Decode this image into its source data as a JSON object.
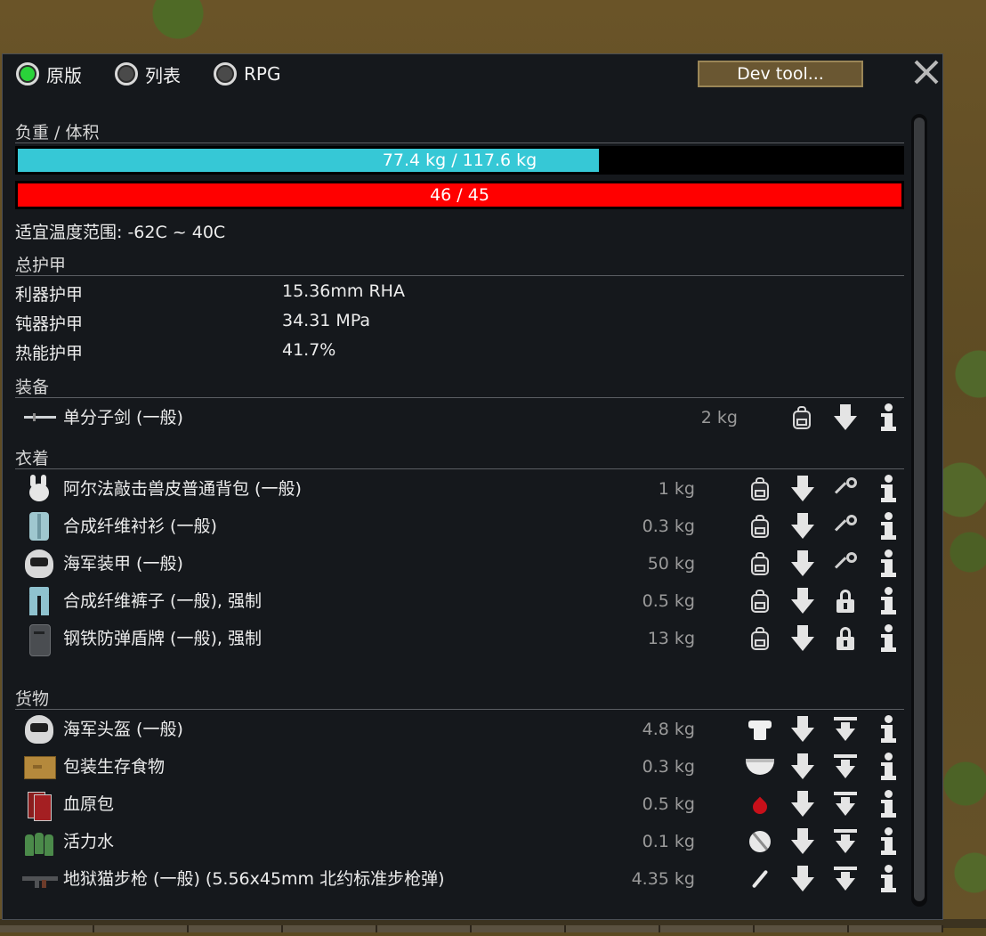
{
  "tabs": {
    "vanilla": "原版",
    "list": "列表",
    "rpg": "RPG",
    "selected": "原版"
  },
  "dev_tool_label": "Dev tool...",
  "load": {
    "title": "负重 / 体积",
    "mass_text": "77.4 kg / 117.6 kg",
    "mass_fraction": 0.658,
    "mass_color": "#36c8d6",
    "bulk_text": "46 / 45",
    "bulk_fraction": 1.0,
    "bulk_color": "#ff0000"
  },
  "temperature": "适宜温度范围: -62C ~ 40C",
  "armor": {
    "title": "总护甲",
    "rows": [
      {
        "label": "利器护甲",
        "value": "15.36mm RHA"
      },
      {
        "label": "钝器护甲",
        "value": "34.31 MPa"
      },
      {
        "label": "热能护甲",
        "value": "41.7%"
      }
    ]
  },
  "equipment": {
    "title": "装备",
    "items": [
      {
        "name": "单分子剑 (一般)",
        "mass": "2 kg",
        "icon": "sword-icon"
      }
    ]
  },
  "apparel": {
    "title": "衣着",
    "items": [
      {
        "name": "阿尔法敲击兽皮普通背包 (一般)",
        "mass": "1 kg",
        "icon": "backpack-icon",
        "lock": "key"
      },
      {
        "name": "合成纤维衬衫 (一般)",
        "mass": "0.3 kg",
        "icon": "shirt-icon",
        "lock": "key"
      },
      {
        "name": "海军装甲 (一般)",
        "mass": "50 kg",
        "icon": "armor-icon",
        "lock": "key"
      },
      {
        "name": "合成纤维裤子 (一般), 强制",
        "mass": "0.5 kg",
        "icon": "pants-icon",
        "lock": "padlock"
      },
      {
        "name": "钢铁防弹盾牌 (一般), 强制",
        "mass": "13 kg",
        "icon": "shield-icon",
        "lock": "padlock"
      }
    ]
  },
  "inventory": {
    "title": "货物",
    "items": [
      {
        "name": "海军头盔 (一般)",
        "mass": "4.8 kg",
        "icon": "helmet-icon",
        "use": "wear"
      },
      {
        "name": "包装生存食物",
        "mass": "0.3 kg",
        "icon": "food-pack-icon",
        "use": "eat"
      },
      {
        "name": "血原包",
        "mass": "0.5 kg",
        "icon": "hemogen-pack-icon",
        "use": "blood"
      },
      {
        "name": "活力水",
        "mass": "0.1 kg",
        "icon": "bottles-icon",
        "use": "drug"
      },
      {
        "name": "地狱猫步枪 (一般) (5.56x45mm 北约标准步枪弹)",
        "mass": "4.35 kg",
        "icon": "rifle-icon",
        "use": "weapon"
      }
    ]
  }
}
